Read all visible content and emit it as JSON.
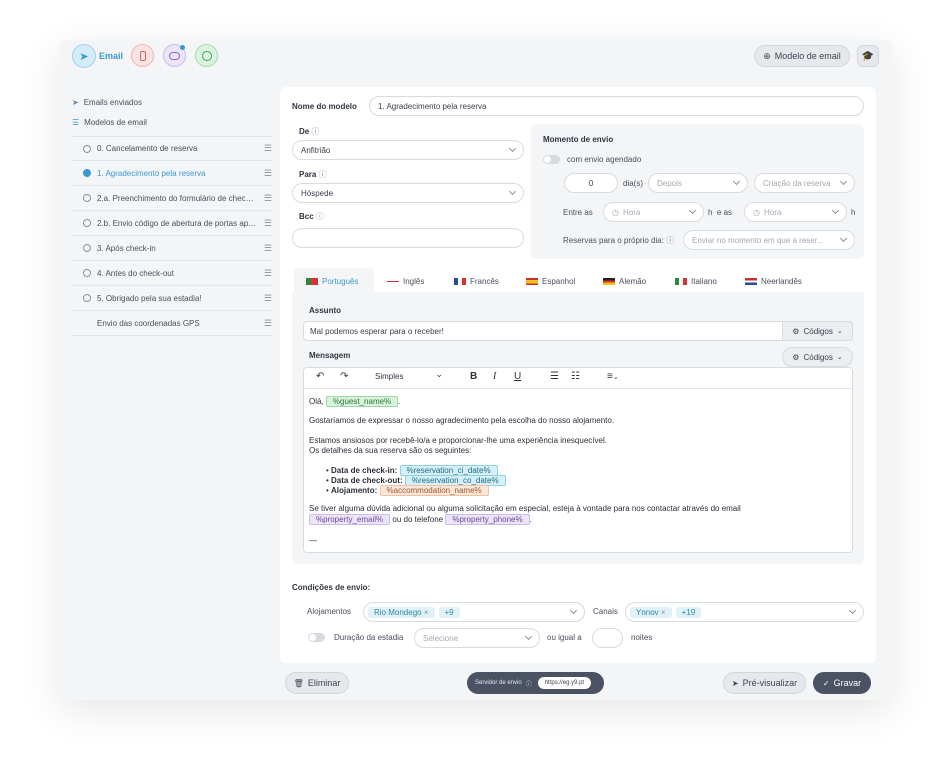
{
  "header": {
    "email_label": "Email",
    "model_button": "Modelo de email"
  },
  "sidebar": {
    "sent": "Emails enviados",
    "models": "Modelos de email",
    "items": [
      {
        "label": "0. Cancelamento de reserva"
      },
      {
        "label": "1. Agradecimento pela reserva"
      },
      {
        "label": "2.a. Preenchimento do formulário de check-..."
      },
      {
        "label": "2.b. Envio código de abertura de portas após..."
      },
      {
        "label": "3. Após check-in"
      },
      {
        "label": "4. Antes do check-out"
      },
      {
        "label": "5. Obrigado pela sua estadia!"
      },
      {
        "label": "Envio das coordenadas GPS"
      }
    ]
  },
  "form": {
    "model_name_label": "Nome do modelo",
    "model_name_value": "1. Agradecimento pela reserva",
    "de_label": "De",
    "de_value": "Anfitrião",
    "para_label": "Para",
    "para_value": "Hóspede",
    "bcc_label": "Bcc",
    "bcc_value": ""
  },
  "schedule": {
    "title": "Momento de envio",
    "toggle_label": "com envio agendado",
    "days_value": "0",
    "days_unit": "dia(s)",
    "when": "Depois",
    "reference": "Criação da reserva",
    "between": "Entre as",
    "hour1": "Hora",
    "h_and": "h  e as",
    "hour2": "Hora",
    "h": "h",
    "same_day_label": "Reservas para o próprio dia:",
    "same_day_value": "Enviar no momento em que a reser..."
  },
  "tabs": [
    "Português",
    "Inglês",
    "Francês",
    "Espanhol",
    "Alemão",
    "Italiano",
    "Neerlandês"
  ],
  "subject": {
    "label": "Assunto",
    "value": "Mal podemos esperar para o receber!",
    "codes": "Códigos"
  },
  "message": {
    "label": "Mensagem",
    "codes": "Códigos",
    "style": "Simples",
    "greeting": "Olá,",
    "tag_guest": "%guest_name%",
    "dot": ".",
    "p1": "Gostaríamos de expressar o nosso agradecimento pela escolha do nosso alojamento.",
    "p2a": "Estamos ansiosos por recebê-lo/a e proporcionar-lhe uma experiência inesquecível.",
    "p2b": "Os detalhes da sua reserva são os seguintes:",
    "li1": "Data de check-in:",
    "tag_ci": "%reservation_ci_date%",
    "li2": "Data de check-out:",
    "tag_co": "%reservation_co_date%",
    "li3": "Alojamento:",
    "tag_acc": "%accommodation_name%",
    "p3": "Se tiver alguma dúvida adicional ou alguma solicitação em especial, esteja à vontade para nos contactar através do email",
    "tag_email": "%property_email%",
    "or_phone": "ou do telefone",
    "tag_phone": "%property_phone%",
    "sig": "—"
  },
  "conditions": {
    "title": "Condições de envio:",
    "acc_label": "Alojamentos",
    "acc_chip": "Rio Mondego",
    "acc_more": "+9",
    "channels_label": "Canais",
    "channel_chip": "Ynnov",
    "channel_more": "+19",
    "stay_label": "Duração da estadia",
    "stay_select": "Selecione",
    "or_equal": "ou igual a",
    "nights": "noites"
  },
  "footer": {
    "delete": "Eliminar",
    "server_label": "Servidor de envio",
    "server_value": "https://eg.y9.pt",
    "preview": "Pré-visualizar",
    "save": "Gravar"
  },
  "colors": {
    "accent": "#4aa8d8",
    "save": "#4a5263"
  }
}
